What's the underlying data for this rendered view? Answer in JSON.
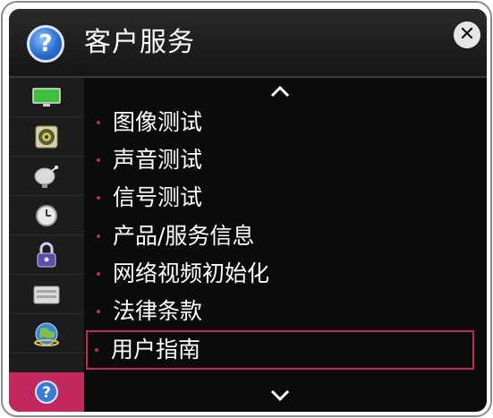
{
  "header": {
    "title": "客户服务",
    "help_glyph": "?",
    "close_glyph": "✕"
  },
  "sidebar": {
    "items": [
      {
        "name": "picture-icon"
      },
      {
        "name": "sound-icon"
      },
      {
        "name": "channel-icon"
      },
      {
        "name": "time-icon"
      },
      {
        "name": "lock-icon"
      },
      {
        "name": "option-icon"
      },
      {
        "name": "network-icon"
      },
      {
        "name": "support-icon",
        "active": true
      }
    ]
  },
  "menu": {
    "items": [
      {
        "label": "图像测试"
      },
      {
        "label": "声音测试"
      },
      {
        "label": "信号测试"
      },
      {
        "label": "产品/服务信息"
      },
      {
        "label": "网络视频初始化"
      },
      {
        "label": "法律条款"
      },
      {
        "label": "用户指南",
        "selected": true
      }
    ]
  },
  "colors": {
    "accent": "#c2275e",
    "panel": "#0b0b0b",
    "sidebar": "#1c1c1c",
    "text": "#ffffff"
  }
}
